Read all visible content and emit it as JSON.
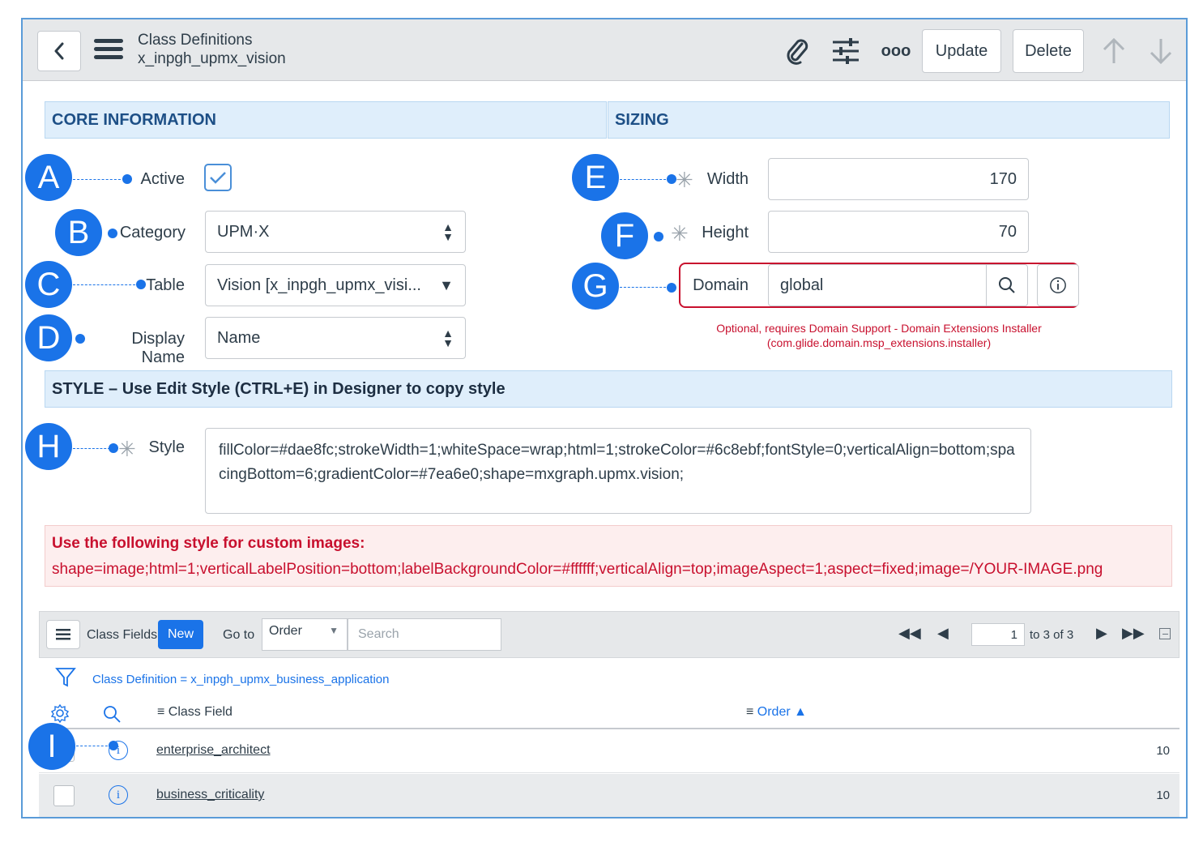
{
  "header": {
    "title": "Class Definitions",
    "subtitle": "x_inpgh_upmx_vision",
    "update_label": "Update",
    "delete_label": "Delete",
    "more_label": "ooo"
  },
  "sections": {
    "core": "CORE INFORMATION",
    "sizing": "SIZING",
    "style": "STYLE – Use Edit Style (CTRL+E) in Designer to copy style"
  },
  "fields": {
    "active_label": "Active",
    "active_checked": true,
    "category_label": "Category",
    "category_value": "UPM·X",
    "table_label": "Table",
    "table_value": "Vision [x_inpgh_upmx_visi...",
    "display_name_label": "Display Name",
    "display_name_value": "Name",
    "width_label": "Width",
    "width_value": "170",
    "height_label": "Height",
    "height_value": "70",
    "domain_label": "Domain",
    "domain_value": "global",
    "domain_note_1": "Optional, requires Domain Support - Domain Extensions Installer",
    "domain_note_2": "(com.glide.domain.msp_extensions.installer)",
    "style_label": "Style",
    "style_value": "fillColor=#dae8fc;strokeWidth=1;whiteSpace=wrap;html=1;strokeColor=#6c8ebf;fontStyle=0;verticalAlign=bottom;spacingBottom=6;gradientColor=#7ea6e0;shape=mxgraph.upmx.vision;"
  },
  "alert": {
    "line1": "Use the following style for custom images:",
    "line2": "shape=image;html=1;verticalLabelPosition=bottom;labelBackgroundColor=#ffffff;verticalAlign=top;imageAspect=1;aspect=fixed;image=/YOUR-IMAGE.png"
  },
  "badges": [
    "A",
    "B",
    "C",
    "D",
    "E",
    "F",
    "G",
    "H",
    "I"
  ],
  "related_list": {
    "title": "Class Fields",
    "new_label": "New",
    "goto_label": "Go to",
    "goto_select": "Order",
    "search_placeholder": "Search",
    "page_value": "1",
    "page_total": "to 3 of 3",
    "filter": "Class Definition = x_inpgh_upmx_business_application",
    "col_field": "Class Field",
    "col_order": "Order ▲",
    "rows": [
      {
        "field": "enterprise_architect",
        "order": "10"
      },
      {
        "field": "business_criticality",
        "order": "10"
      }
    ]
  },
  "colors": {
    "accent": "#1a73e8",
    "alert_red": "#c8102e",
    "section_bg": "#dfeefb"
  }
}
